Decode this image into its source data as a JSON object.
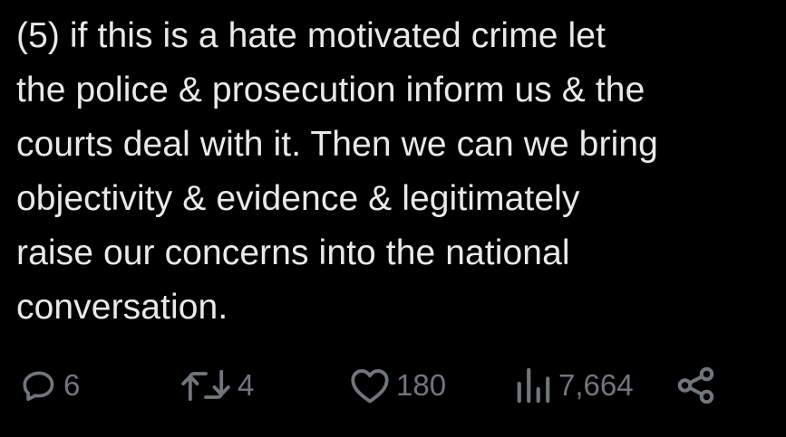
{
  "tweet": {
    "text_lines": [
      "(5) if this is a hate motivated crime let",
      "the police & prosecution inform us & the",
      "courts deal with it. Then we can we bring",
      "objectivity & evidence & legitimately",
      "raise our concerns into the national",
      "conversation."
    ]
  },
  "actions": {
    "reply_count": "6",
    "retweet_count": "4",
    "like_count": "180",
    "views_count": "7,664"
  },
  "icons": {
    "reply": "comment-bubble-icon",
    "retweet": "retweet-arrows-icon",
    "like": "heart-icon",
    "views": "bar-chart-icon",
    "share": "share-nodes-icon"
  },
  "colors": {
    "background": "#000000",
    "text": "#e7e9ea",
    "muted": "#71767b"
  }
}
